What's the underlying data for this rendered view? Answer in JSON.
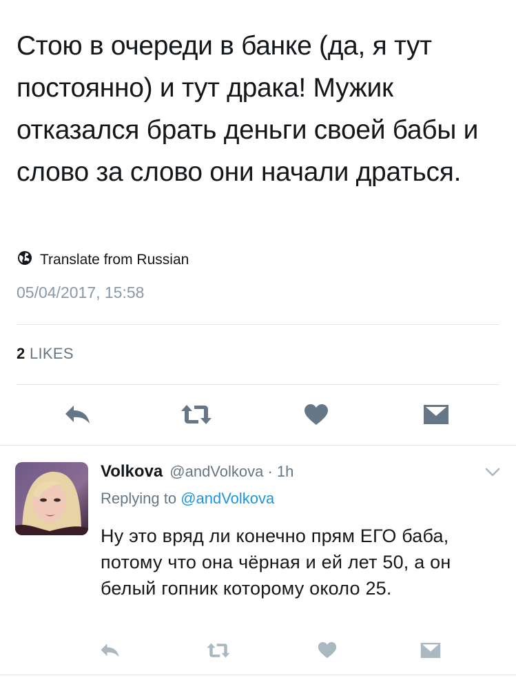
{
  "tweet": {
    "text": "Стою в очереди в банке (да, я тут постоянно) и тут драка! Мужик отказался брать деньги своей бабы и слово за слово они начали драться.",
    "translate_label": "Translate from Russian",
    "timestamp": "05/04/2017, 15:58",
    "likes_count": "2",
    "likes_label": "LIKES"
  },
  "reply": {
    "name": "Volkova",
    "handle_time": "@andVolkova · 1h",
    "replying_prefix": "Replying to ",
    "replying_mention": "@andVolkova",
    "text": "Ну это вряд ли конечно прям ЕГО баба, потому что она чёрная и ей лет 50, а он белый гопник которому около 25."
  },
  "icons": [
    "reply-icon",
    "retweet-icon",
    "like-heart-icon",
    "direct-message-icon",
    "globe-icon",
    "chevron-down-icon"
  ],
  "colors": {
    "text": "#14171a",
    "secondary": "#657786",
    "timestamp": "#8899a6",
    "link": "#1b95e0",
    "action_icon": "#657786",
    "reply_action_icon": "#aab8c2",
    "divider": "#e1e8ed"
  }
}
